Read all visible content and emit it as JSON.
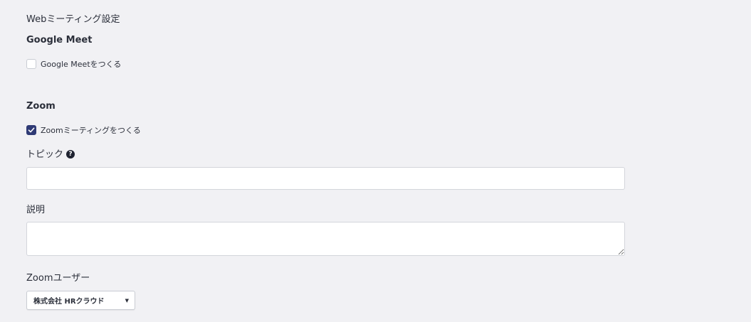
{
  "web_meeting": {
    "section_title": "Webミーティング設定"
  },
  "google_meet": {
    "title": "Google Meet",
    "checkbox_label": "Google Meetをつくる",
    "checked": false
  },
  "zoom": {
    "title": "Zoom",
    "checkbox_label": "Zoomミーティングをつくる",
    "checked": true,
    "topic_label": "トピック",
    "topic_value": "",
    "help_icon": "question-circle-icon",
    "description_label": "説明",
    "description_value": "",
    "user_label": "Zoomユーザー",
    "user_selected": "株式会社 HRクラウド"
  },
  "colors": {
    "checkbox_checked": "#2f3a75",
    "background": "#f1f1f4",
    "text": "#2b2f3a"
  }
}
